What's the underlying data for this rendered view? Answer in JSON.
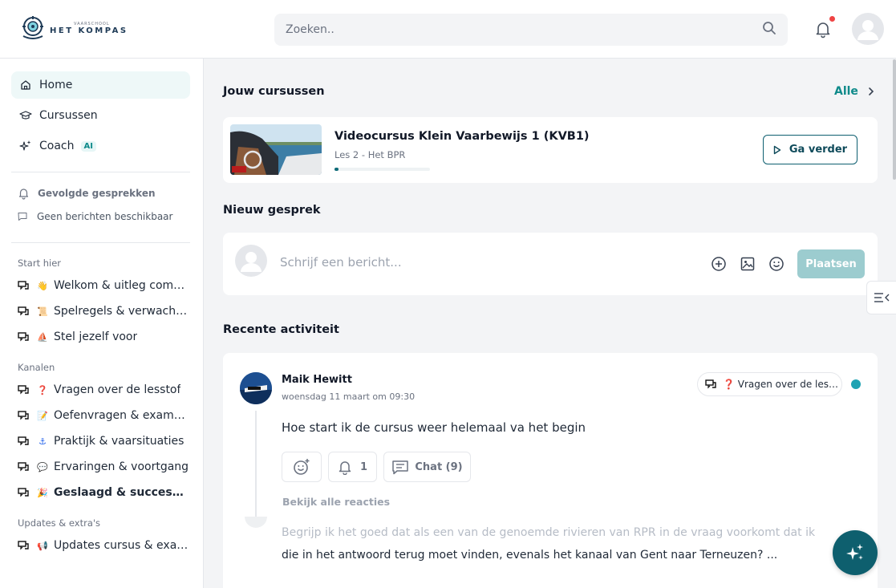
{
  "brand": {
    "small": "VAARSCHOOL",
    "name": "HET KOMPAS"
  },
  "search": {
    "placeholder": "Zoeken.."
  },
  "colors": {
    "accent": "#0e8a8a",
    "primary": "#0e5f6e",
    "notification": "#ef4444"
  },
  "sidebar": {
    "nav": [
      {
        "label": "Home",
        "icon": "home-icon",
        "active": true
      },
      {
        "label": "Cursussen",
        "icon": "graduation-cap-icon"
      },
      {
        "label": "Coach",
        "icon": "sparkles-icon",
        "badge": "AI"
      }
    ],
    "followed": {
      "title": "Gevolgde gesprekken",
      "empty": "Geen berichten beschikbaar"
    },
    "sections": [
      {
        "label": "Start hier",
        "channels": [
          {
            "emoji": "👋",
            "label": "Welkom & uitleg community"
          },
          {
            "emoji": "📜",
            "label": "Spelregels & verwachtingen"
          },
          {
            "emoji": "⛵",
            "label": "Stel jezelf voor"
          }
        ]
      },
      {
        "label": "Kanalen",
        "channels": [
          {
            "emoji": "❓",
            "label": "Vragen over de lesstof"
          },
          {
            "emoji": "📝",
            "label": "Oefenvragen & examentraining"
          },
          {
            "emoji": "⚓",
            "label": "Praktijk & vaarsituaties"
          },
          {
            "emoji": "💬",
            "label": "Ervaringen & voortgang"
          },
          {
            "emoji": "🎉",
            "label": "Geslaagd & successen"
          }
        ]
      },
      {
        "label": "Updates & extra's",
        "channels": [
          {
            "emoji": "📢",
            "label": "Updates cursus & examen"
          }
        ]
      }
    ]
  },
  "main": {
    "courses": {
      "title": "Jouw cursussen",
      "all_label": "Alle",
      "item": {
        "title": "Videocursus Klein Vaarbewijs 1 (KVB1)",
        "lesson": "Les 2 - Het BPR",
        "progress": 0.04,
        "button": "Ga verder"
      }
    },
    "new_post": {
      "title": "Nieuw gesprek",
      "placeholder": "Schrijf een bericht...",
      "submit": "Plaatsen"
    },
    "activity": {
      "title": "Recente activiteit",
      "post": {
        "author": "Maik Hewitt",
        "date": "woensdag 11 maart om 09:30",
        "channel": "❓ Vragen over de lesstof",
        "body": "Hoe start ik de cursus weer helemaal va het begin",
        "bell_count": "1",
        "chat_label": "Chat (9)",
        "view_replies": "Bekijk alle reacties",
        "reply_line1": "Begrijp ik het goed dat als een van de genoemde rivieren van RPR in de vraag voorkomt dat ik",
        "reply_line2": "die in het antwoord terug moet vinden, evenals het kanaal van Gent naar Terneuzen? ..."
      }
    }
  }
}
